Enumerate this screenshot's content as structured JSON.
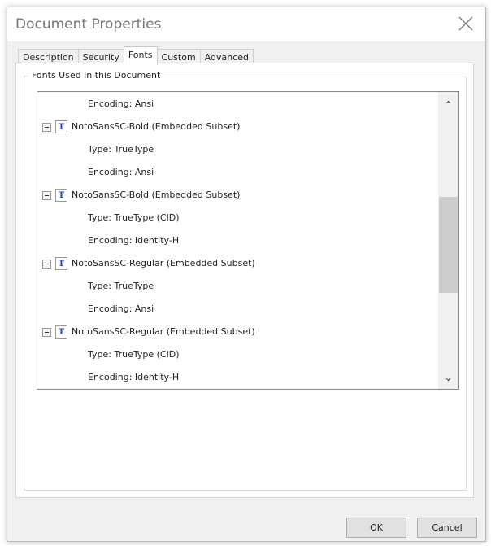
{
  "dialog": {
    "title": "Document Properties"
  },
  "tabs": [
    {
      "label": "Description"
    },
    {
      "label": "Security"
    },
    {
      "label": "Fonts"
    },
    {
      "label": "Custom"
    },
    {
      "label": "Advanced"
    }
  ],
  "group_label": "Fonts Used in this Document",
  "rows": [
    {
      "kind": "prop",
      "text": "Encoding: Ansi"
    },
    {
      "kind": "font",
      "text": "NotoSansSC-Bold (Embedded Subset)"
    },
    {
      "kind": "prop",
      "text": "Type: TrueType"
    },
    {
      "kind": "prop",
      "text": "Encoding: Ansi"
    },
    {
      "kind": "font",
      "text": "NotoSansSC-Bold (Embedded Subset)"
    },
    {
      "kind": "prop",
      "text": "Type: TrueType (CID)"
    },
    {
      "kind": "prop",
      "text": "Encoding: Identity-H"
    },
    {
      "kind": "font",
      "text": "NotoSansSC-Regular (Embedded Subset)"
    },
    {
      "kind": "prop",
      "text": "Type: TrueType"
    },
    {
      "kind": "prop",
      "text": "Encoding: Ansi"
    },
    {
      "kind": "font",
      "text": "NotoSansSC-Regular (Embedded Subset)"
    },
    {
      "kind": "prop",
      "text": "Type: TrueType (CID)"
    },
    {
      "kind": "prop",
      "text": "Encoding: Identity-H"
    }
  ],
  "font_icon_glyph": "T",
  "buttons": {
    "ok": "OK",
    "cancel": "Cancel"
  }
}
